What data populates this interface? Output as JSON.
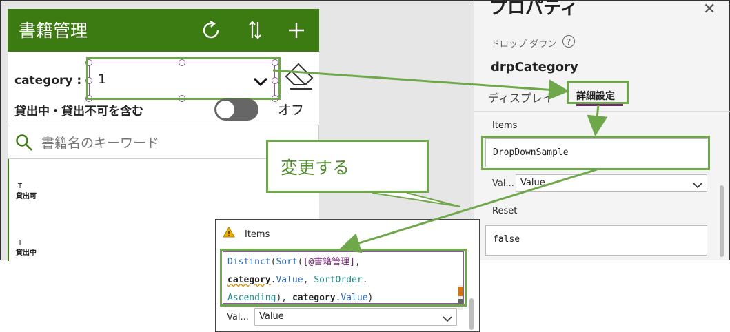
{
  "app": {
    "title": "書籍管理",
    "category_label": "category :",
    "dropdown_value": "1",
    "toggle_label": "貸出中・貸出不可を含む",
    "toggle_state": "オフ",
    "search_placeholder": "書籍名のキーワード",
    "list": [
      {
        "category": "IT",
        "status": "貸出可"
      },
      {
        "category": "IT",
        "status": "貸出中"
      }
    ],
    "header_icons": [
      "refresh-icon",
      "sort-icon",
      "add-icon"
    ]
  },
  "properties": {
    "title": "プロパティ",
    "control_type": "ドロップ ダウン",
    "control_name": "drpCategory",
    "tabs": [
      "ディスプレイ",
      "詳細設定"
    ],
    "items_label": "Items",
    "items_value": "DropDownSample",
    "value_short_label": "Val...",
    "value_select": "Value",
    "reset_label": "Reset",
    "reset_value": "false"
  },
  "callout": {
    "text": "変更する"
  },
  "formula_panel": {
    "title": "Items",
    "line1": [
      "Distinct",
      "(",
      "Sort",
      "(",
      "[",
      "@書籍管理",
      "]",
      ","
    ],
    "line2": [
      "category",
      ".",
      "Value",
      ",",
      " ",
      "SortOrder",
      "."
    ],
    "line3": [
      "Ascending",
      ")",
      ",",
      " ",
      "category",
      ".",
      "Value",
      ")"
    ],
    "value_short_label": "Val...",
    "value_select": "Value"
  },
  "colors": {
    "header_green": "#3c7a12",
    "highlight_green": "#6fa84a",
    "selection_purple": "#8a5b9a"
  }
}
